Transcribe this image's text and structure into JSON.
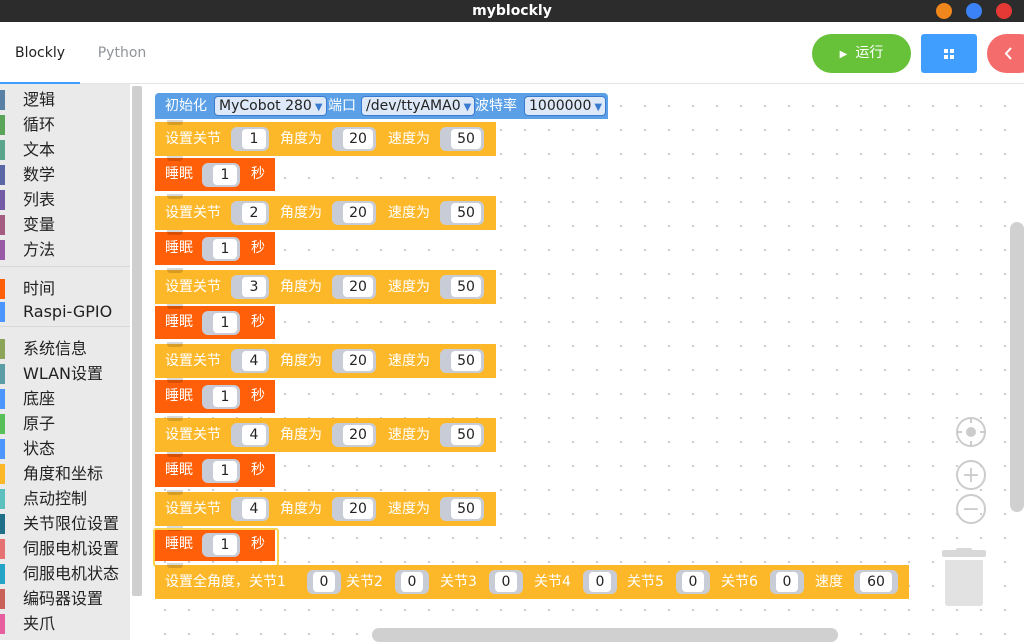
{
  "window": {
    "title": "myblockly"
  },
  "tabs": {
    "blockly": "Blockly",
    "python": "Python"
  },
  "toolbar": {
    "run_label": "运行"
  },
  "toolbox": {
    "group1": [
      "逻辑",
      "循环",
      "文本",
      "数学",
      "列表",
      "变量",
      "方法"
    ],
    "group2": [
      "时间",
      "Raspi-GPIO"
    ],
    "group3": [
      "系统信息",
      "WLAN设置",
      "底座",
      "原子",
      "状态",
      "角度和坐标",
      "点动控制",
      "关节限位设置",
      "伺服电机设置",
      "伺服电机状态",
      "编码器设置",
      "夹爪"
    ]
  },
  "colors": {
    "group1": [
      "#5b80a5",
      "#5ba55b",
      "#5ba58c",
      "#5b67a5",
      "#745ba5",
      "#a55b80",
      "#995ba5"
    ],
    "group2": [
      "#fe5f08",
      "#4c97ff"
    ],
    "group3": [
      "#8da55b",
      "#5b9ea5",
      "#4c97ff",
      "#59c059",
      "#4c97ff",
      "#fdb82a",
      "#5bc0be",
      "#1f6f8b",
      "#e57373",
      "#26a4c7",
      "#c9635a",
      "#e85fa0"
    ]
  },
  "init_block": {
    "label": "初始化",
    "model": "MyCobot 280",
    "port_label": "端口",
    "port": "/dev/ttyAMA0",
    "baud_label": "波特率",
    "baud": "1000000"
  },
  "set_joint": {
    "label": "设置关节",
    "angle_label": "角度为",
    "speed_label": "速度为"
  },
  "sleep": {
    "label": "睡眠",
    "unit": "秒"
  },
  "sequence": [
    {
      "joint": "1",
      "angle": "20",
      "speed": "50",
      "sleep": "1"
    },
    {
      "joint": "2",
      "angle": "20",
      "speed": "50",
      "sleep": "1"
    },
    {
      "joint": "3",
      "angle": "20",
      "speed": "50",
      "sleep": "1"
    },
    {
      "joint": "4",
      "angle": "20",
      "speed": "50",
      "sleep": "1"
    },
    {
      "joint": "4",
      "angle": "20",
      "speed": "50",
      "sleep": "1"
    },
    {
      "joint": "4",
      "angle": "20",
      "speed": "50",
      "sleep": "1"
    }
  ],
  "all_angles": {
    "label": "设置全角度，关节1",
    "j1": "0",
    "j2_label": "关节2",
    "j2": "0",
    "j3_label": "关节3",
    "j3": "0",
    "j4_label": "关节4",
    "j4": "0",
    "j5_label": "关节5",
    "j5": "0",
    "j6_label": "关节6",
    "j6": "0",
    "speed_label": "速度",
    "speed": "60"
  }
}
